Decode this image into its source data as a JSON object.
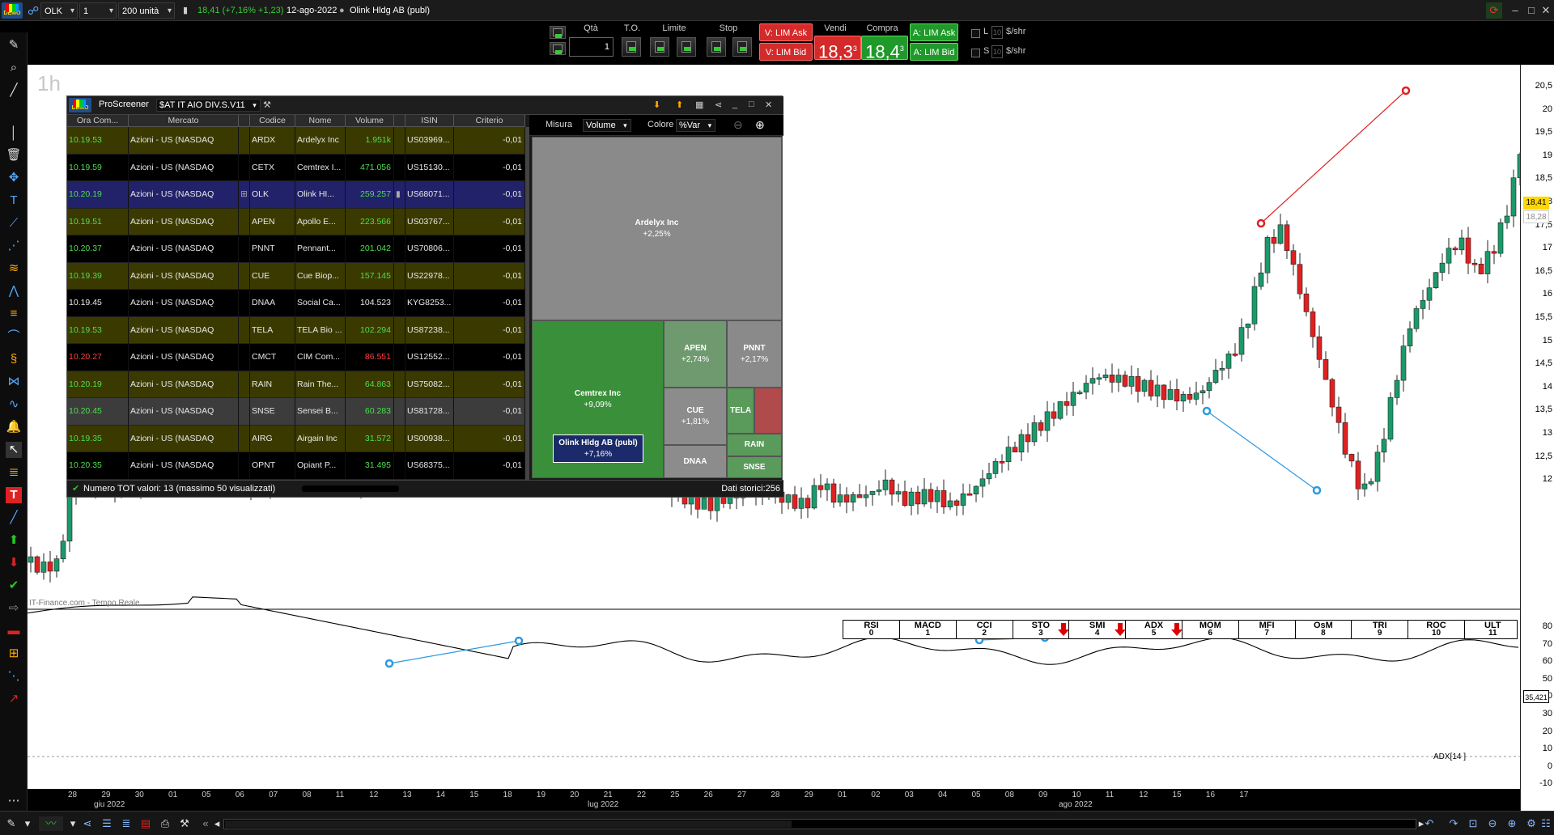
{
  "topbar": {
    "symbol": "OLK",
    "timeframe": "1 ora",
    "units": "200 unità",
    "price_line": "18,41 (+7,16% +1,23)",
    "date": "12-ago-2022",
    "instrument": "Olink Hldg AB (publ)",
    "demo_label": "DEMO"
  },
  "orderbar": {
    "qta_label": "Qtà",
    "qta_value": "1",
    "to_label": "T.O.",
    "limite_label": "Limite",
    "stop_label": "Stop",
    "vendi_label": "Vendi",
    "compra_label": "Compra",
    "v_lim_ask": "V: LIM Ask",
    "v_lim_bid": "V: LIM Bid",
    "bid_price": "18,3",
    "bid_sup": "3",
    "ask_price": "18,4",
    "ask_sup": "3",
    "a_lim_ask": "A: LIM Ask",
    "a_lim_bid": "A: LIM Bid",
    "l_label": "L",
    "s_label": "S",
    "ten": "10",
    "shr": "$/shr"
  },
  "chart": {
    "timeframe_label": "1h",
    "source_label": "IT-Finance.com - Tempo Reale",
    "last_price": "18,41",
    "last_price_2": "18,28",
    "adx_value": "35,421",
    "adx_label": "ADX[14 ]",
    "y_ticks": [
      "20,5",
      "20",
      "19,5",
      "19",
      "18,5",
      "18",
      "17,5",
      "17",
      "16,5",
      "16",
      "15,5",
      "15",
      "14,5",
      "14",
      "13,5",
      "13",
      "12,5",
      "12"
    ],
    "ind_y_ticks": [
      "80",
      "70",
      "60",
      "50",
      "40",
      "30",
      "20",
      "10",
      "0",
      "-10"
    ],
    "x_dates": [
      "28",
      "29",
      "30",
      "01",
      "05",
      "06",
      "07",
      "08",
      "11",
      "12",
      "13",
      "14",
      "15",
      "18",
      "19",
      "20",
      "21",
      "22",
      "25",
      "26",
      "27",
      "28",
      "29",
      "01",
      "02",
      "03",
      "04",
      "05",
      "08",
      "09",
      "10",
      "11",
      "12",
      "15",
      "16",
      "17"
    ],
    "months": [
      "giu 2022",
      "lug 2022",
      "ago 2022"
    ],
    "indicator_tabs": [
      {
        "name": "RSI",
        "num": "0",
        "arrow": false
      },
      {
        "name": "MACD",
        "num": "1",
        "arrow": false
      },
      {
        "name": "CCI",
        "num": "2",
        "arrow": false
      },
      {
        "name": "STO",
        "num": "3",
        "arrow": true
      },
      {
        "name": "SMI",
        "num": "4",
        "arrow": true
      },
      {
        "name": "ADX",
        "num": "5",
        "arrow": true
      },
      {
        "name": "MOM",
        "num": "6",
        "arrow": false
      },
      {
        "name": "MFI",
        "num": "7",
        "arrow": false
      },
      {
        "name": "OsM",
        "num": "8",
        "arrow": false
      },
      {
        "name": "TRI",
        "num": "9",
        "arrow": false
      },
      {
        "name": "ROC",
        "num": "10",
        "arrow": false
      },
      {
        "name": "ULT",
        "num": "11",
        "arrow": false
      }
    ]
  },
  "proscreener": {
    "title": "ProScreener",
    "screen_name": "$AT IT AIO DIV.S.V11",
    "columns": [
      "Ora Com...",
      "Mercato",
      "",
      "Codice",
      "Nome",
      "Volume",
      "",
      "ISIN",
      "Criterio"
    ],
    "measure_label": "Misura",
    "measure_value": "Volume",
    "color_label": "Colore",
    "color_value": "%Var",
    "footer_left": "Numero TOT valori: 13 (massimo 50 visualizzati)",
    "footer_right": "Dati storici:256",
    "rows": [
      {
        "time": "10.19.53",
        "market": "Azioni - US (NASDAQ",
        "code": "ARDX",
        "name": "Ardelyx Inc",
        "volume": "1.951k",
        "isin": "US03969...",
        "crit": "-0,01",
        "tcolor": "#4cdf4c",
        "vcolor": "#4cdf4c",
        "bg": "#3a3a00"
      },
      {
        "time": "10.19.59",
        "market": "Azioni - US (NASDAQ",
        "code": "CETX",
        "name": "Cemtrex I...",
        "volume": "471.056",
        "isin": "US15130...",
        "crit": "-0,01",
        "tcolor": "#4cdf4c",
        "vcolor": "#4cdf4c",
        "bg": "#000"
      },
      {
        "time": "10.20.19",
        "market": "Azioni - US (NASDAQ",
        "code": "OLK",
        "name": "Olink HI...",
        "volume": "259.257",
        "isin": "US68071...",
        "crit": "-0,01",
        "tcolor": "#4cdf4c",
        "vcolor": "#4cdf4c",
        "bg": "#22226a"
      },
      {
        "time": "10.19.51",
        "market": "Azioni - US (NASDAQ",
        "code": "APEN",
        "name": "Apollo E...",
        "volume": "223.566",
        "isin": "US03767...",
        "crit": "-0,01",
        "tcolor": "#4cdf4c",
        "vcolor": "#4cdf4c",
        "bg": "#3a3a00"
      },
      {
        "time": "10.20.37",
        "market": "Azioni - US (NASDAQ",
        "code": "PNNT",
        "name": "Pennant...",
        "volume": "201.042",
        "isin": "US70806...",
        "crit": "-0,01",
        "tcolor": "#4cdf4c",
        "vcolor": "#4cdf4c",
        "bg": "#000"
      },
      {
        "time": "10.19.39",
        "market": "Azioni - US (NASDAQ",
        "code": "CUE",
        "name": "Cue Biop...",
        "volume": "157.145",
        "isin": "US22978...",
        "crit": "-0,01",
        "tcolor": "#4cdf4c",
        "vcolor": "#4cdf4c",
        "bg": "#3a3a00"
      },
      {
        "time": "10.19.45",
        "market": "Azioni - US (NASDAQ",
        "code": "DNAA",
        "name": "Social Ca...",
        "volume": "104.523",
        "isin": "KYG8253...",
        "crit": "-0,01",
        "tcolor": "#e8e8e8",
        "vcolor": "#e8e8e8",
        "bg": "#000"
      },
      {
        "time": "10.19.53",
        "market": "Azioni - US (NASDAQ",
        "code": "TELA",
        "name": "TELA Bio ...",
        "volume": "102.294",
        "isin": "US87238...",
        "crit": "-0,01",
        "tcolor": "#4cdf4c",
        "vcolor": "#4cdf4c",
        "bg": "#3a3a00"
      },
      {
        "time": "10.20.27",
        "market": "Azioni - US (NASDAQ",
        "code": "CMCT",
        "name": "CIM Com...",
        "volume": "86.551",
        "isin": "US12552...",
        "crit": "-0,01",
        "tcolor": "#ff4040",
        "vcolor": "#ff4040",
        "bg": "#000"
      },
      {
        "time": "10.20.19",
        "market": "Azioni - US (NASDAQ",
        "code": "RAIN",
        "name": "Rain The...",
        "volume": "64.863",
        "isin": "US75082...",
        "crit": "-0,01",
        "tcolor": "#4cdf4c",
        "vcolor": "#4cdf4c",
        "bg": "#3a3a00"
      },
      {
        "time": "10.20.45",
        "market": "Azioni - US (NASDAQ",
        "code": "SNSE",
        "name": "Sensei B...",
        "volume": "60.283",
        "isin": "US81728...",
        "crit": "-0,01",
        "tcolor": "#4cdf4c",
        "vcolor": "#4cdf4c",
        "bg": "#3c3c3c"
      },
      {
        "time": "10.19.35",
        "market": "Azioni - US (NASDAQ",
        "code": "AIRG",
        "name": "Airgain Inc",
        "volume": "31.572",
        "isin": "US00938...",
        "crit": "-0,01",
        "tcolor": "#4cdf4c",
        "vcolor": "#4cdf4c",
        "bg": "#3a3a00"
      },
      {
        "time": "10.20.35",
        "market": "Azioni - US (NASDAQ",
        "code": "OPNT",
        "name": "Opiant P...",
        "volume": "31.495",
        "isin": "US68375...",
        "crit": "-0,01",
        "tcolor": "#4cdf4c",
        "vcolor": "#4cdf4c",
        "bg": "#000"
      }
    ],
    "treemap": [
      {
        "name": "Ardelyx Inc",
        "pct": "+2,25%",
        "color": "#8a8a8a"
      },
      {
        "name": "Cemtrex Inc",
        "pct": "+9,09%",
        "color": "#3a8f3a"
      },
      {
        "name": "APEN",
        "pct": "+2,74%",
        "color": "#6f9a6f"
      },
      {
        "name": "PNNT",
        "pct": "+2,17%",
        "color": "#8a8a8a"
      },
      {
        "name": "CUE",
        "pct": "+1,81%",
        "color": "#8c8c8c"
      },
      {
        "name": "TELA",
        "pct": "",
        "color": "#5a9a5a"
      },
      {
        "name": "",
        "pct": "",
        "color": "#b14a4a"
      },
      {
        "name": "Olink Hldg AB (publ)",
        "pct": "+7,16%",
        "color": "#1a2a6a"
      },
      {
        "name": "DNAA",
        "pct": "",
        "color": "#8c8c8c"
      },
      {
        "name": "RAIN",
        "pct": "",
        "color": "#5a9a5a"
      },
      {
        "name": "SNSE",
        "pct": "",
        "color": "#5a9a5a"
      }
    ]
  }
}
